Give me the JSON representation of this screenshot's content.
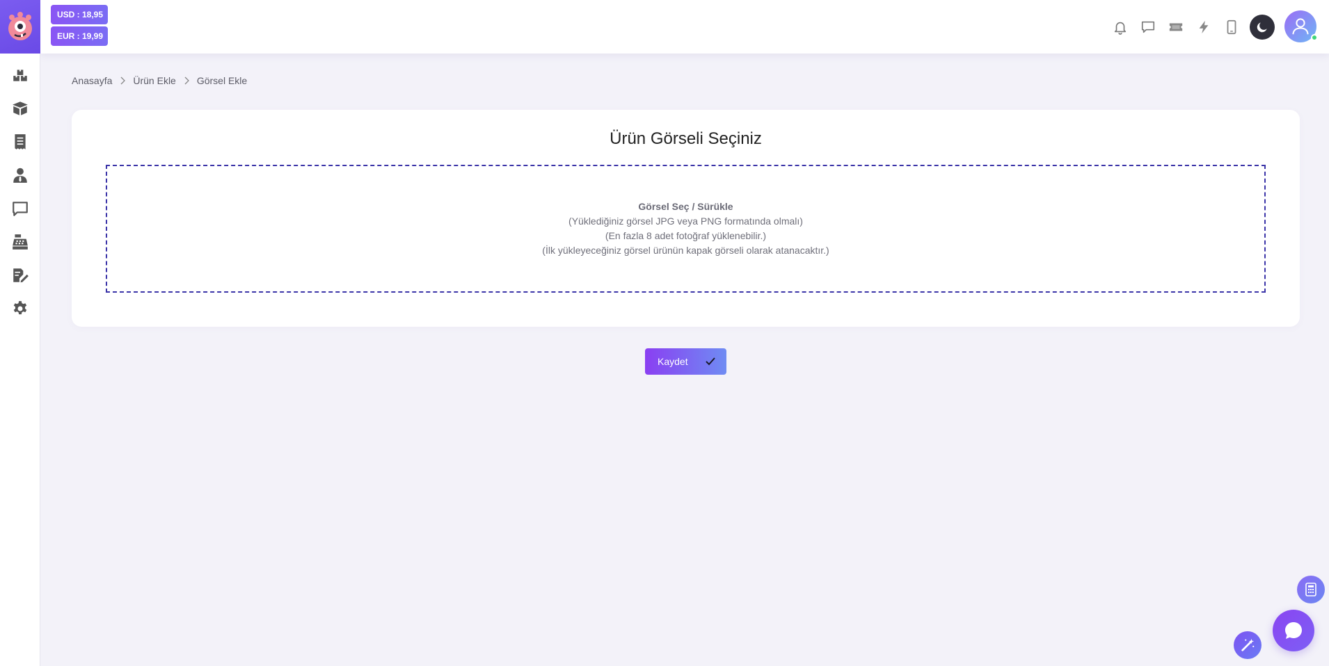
{
  "currency": {
    "usd": "USD : 18,95",
    "eur": "EUR : 19,99"
  },
  "sidebar": {
    "items": [
      {
        "icon": "boxes-icon"
      },
      {
        "icon": "open-box-icon"
      },
      {
        "icon": "receipt-icon"
      },
      {
        "icon": "user-tie-icon"
      },
      {
        "icon": "message-icon"
      },
      {
        "icon": "cash-register-icon"
      },
      {
        "icon": "signature-icon"
      },
      {
        "icon": "gear-icon"
      }
    ]
  },
  "topbar": {
    "icons": [
      "bell-icon",
      "chat-icon",
      "ticket-icon",
      "bolt-icon",
      "mobile-icon",
      "moon-icon",
      "avatar"
    ]
  },
  "breadcrumb": {
    "home": "Anasayfa",
    "parent": "Ürün Ekle",
    "current": "Görsel Ekle"
  },
  "upload": {
    "title": "Ürün Görseli Seçiniz",
    "dz_title": "Görsel Seç / Sürükle",
    "dz_line1": "(Yüklediğiniz görsel JPG veya PNG formatında olmalı)",
    "dz_line2": "(En fazla 8 adet fotoğraf yüklenebilir.)",
    "dz_line3": "(İlk yükleyeceğiniz görsel ürünün kapak görseli olarak atanacaktır.)"
  },
  "actions": {
    "save_label": "Kaydet"
  },
  "colors": {
    "accent": "#7b5cf0",
    "dropzone_border": "#3b34a8",
    "background": "#f3f2f9",
    "online": "#3fd57a"
  }
}
